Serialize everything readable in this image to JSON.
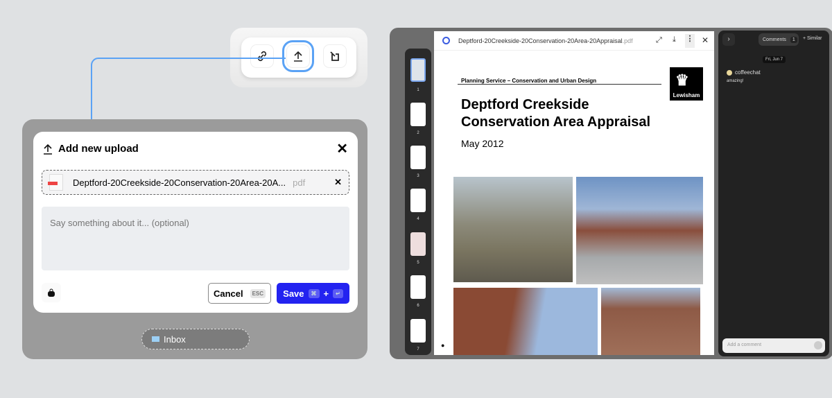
{
  "toolbar": {
    "buttons": [
      {
        "icon": "link-icon"
      },
      {
        "icon": "upload-icon",
        "selected": true
      },
      {
        "icon": "note-icon"
      }
    ]
  },
  "accent": "#5aa2f5",
  "dialog": {
    "title": "Add new upload",
    "file_name": "Deptford-20Creekside-20Conservation-20Area-20A...",
    "file_ext": "pdf",
    "comment_placeholder": "Say something about it... (optional)",
    "cancel_label": "Cancel",
    "cancel_key": "ESC",
    "save_label": "Save",
    "save_key1": "⌘",
    "save_plus": "+",
    "save_key2": "↵",
    "save_color": "#2323f0"
  },
  "inbox_label": "Inbox",
  "viewer": {
    "file_name": "Deptford-20Creekside-20Conservation-20Area-20Appraisal",
    "file_ext": ".pdf",
    "thumbs": [
      "1",
      "2",
      "3",
      "4",
      "5",
      "6",
      "7"
    ],
    "doc": {
      "header": "Planning Service – Conservation and Urban Design",
      "title1": "Deptford Creekside",
      "title2": "Conservation Area Appraisal",
      "date": "May 2012",
      "logo": "Lewisham"
    }
  },
  "comments": {
    "tab_label": "Comments",
    "count": "1",
    "similar_label": "+ Similar",
    "date": "Fri, Jun 7",
    "user": "coffeechat",
    "text": "amazing!",
    "input_placeholder": "Add a comment"
  }
}
